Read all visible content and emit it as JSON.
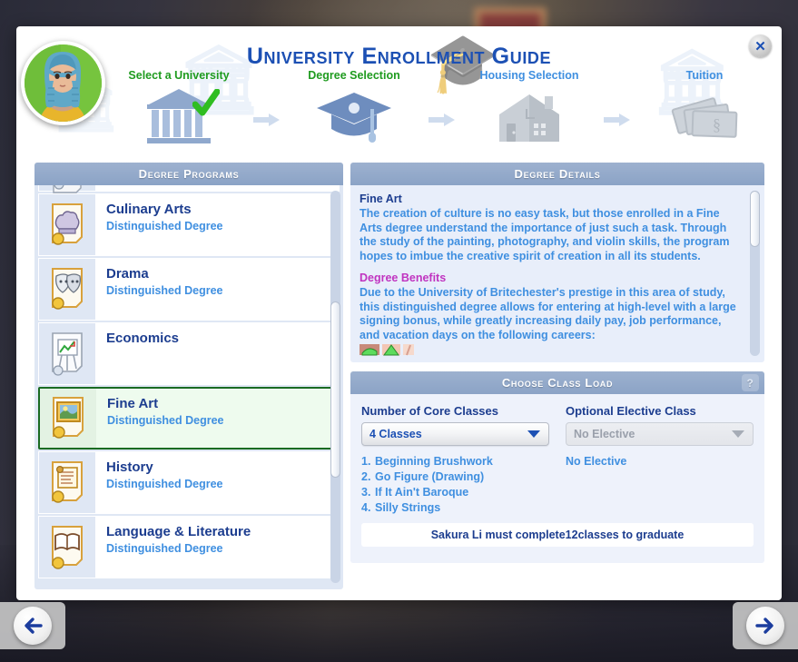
{
  "window": {
    "title": "University Enrollment Guide",
    "close_label": "✕"
  },
  "avatar": {
    "name": "sim-portrait"
  },
  "steps": [
    {
      "label": "Select a University",
      "state": "done",
      "icon": "university-building-icon",
      "check": true
    },
    {
      "label": "Degree Selection",
      "state": "active",
      "icon": "graduation-cap-icon",
      "check": false
    },
    {
      "label": "Housing Selection",
      "state": "todo",
      "icon": "house-icon",
      "check": false
    },
    {
      "label": "Tuition",
      "state": "todo",
      "icon": "money-bills-icon",
      "check": false
    }
  ],
  "degree_programs": {
    "header": "Degree Programs",
    "items": [
      {
        "name": "",
        "sub": "",
        "icon": "computer-diploma-icon",
        "selected": false,
        "partial": true
      },
      {
        "name": "Culinary Arts",
        "sub": "Distinguished Degree",
        "icon": "chef-hat-diploma-icon",
        "selected": false
      },
      {
        "name": "Drama",
        "sub": "Distinguished Degree",
        "icon": "theater-masks-diploma-icon",
        "selected": false
      },
      {
        "name": "Economics",
        "sub": "",
        "icon": "easel-chart-diploma-icon",
        "selected": false
      },
      {
        "name": "Fine Art",
        "sub": "Distinguished Degree",
        "icon": "painting-diploma-icon",
        "selected": true
      },
      {
        "name": "History",
        "sub": "Distinguished Degree",
        "icon": "scroll-diploma-icon",
        "selected": false
      },
      {
        "name": "Language & Literature",
        "sub": "Distinguished Degree",
        "icon": "open-book-diploma-icon",
        "selected": false
      }
    ]
  },
  "degree_details": {
    "header": "Degree Details",
    "title": "Fine Art",
    "description": "The creation of culture is no easy task, but those enrolled in a Fine Arts degree understand the importance of just such a task. Through the study of the painting, photography, and violin skills, the program hopes to imbue the creative spirit of creation in all its students.",
    "benefits_header": "Degree Benefits",
    "benefits_text": "Due to the University of Britechester's prestige in this area of study, this distinguished degree allows for entering at high-level with a large signing bonus, while greatly increasing daily pay, job performance, and vacation days on the following careers:"
  },
  "class_load": {
    "header": "Choose Class Load",
    "help_label": "?",
    "core_label": "Number of Core Classes",
    "core_value": "4 Classes",
    "elective_label": "Optional Elective Class",
    "elective_value": "No Elective",
    "core_classes": [
      {
        "num": "1.",
        "name": "Beginning Brushwork"
      },
      {
        "num": "2.",
        "name": "Go Figure (Drawing)"
      },
      {
        "num": "3.",
        "name": "If It Ain't Baroque"
      },
      {
        "num": "4.",
        "name": "Silly Strings"
      }
    ],
    "elective_classes": [
      "No Elective"
    ],
    "graduation_note_pre": "Sakura Li must complete ",
    "graduation_note_count": "12",
    "graduation_note_post": " classes to graduate"
  },
  "nav": {
    "back_label": "←",
    "next_label": "→"
  },
  "colors": {
    "title_blue": "#1c50b4",
    "step_done_green": "#1f9b1f",
    "step_todo_blue": "#3f8fe0",
    "pane_header": "#8ba3c6",
    "body_blue": "#3f8fe0",
    "heading_blue": "#1c3d8f",
    "benefits_magenta": "#c034c0",
    "selected_border": "#1a6b22",
    "selected_bg": "#eefbee"
  }
}
